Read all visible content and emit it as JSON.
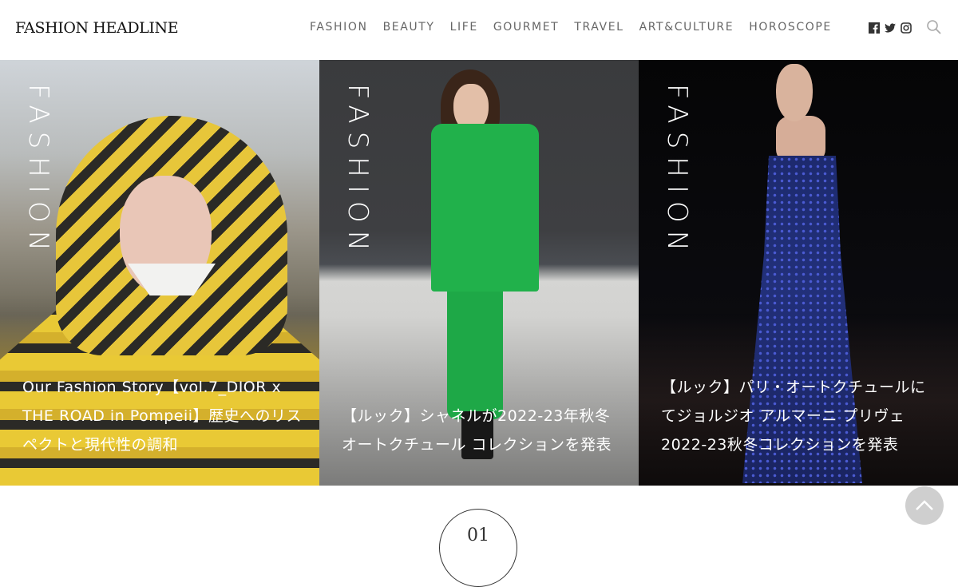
{
  "header": {
    "logo": "FASHION HEADLINE",
    "nav": [
      "FASHION",
      "BEAUTY",
      "LIFE",
      "GOURMET",
      "TRAVEL",
      "ART&CULTURE",
      "HOROSCOPE"
    ],
    "social_icons": [
      "facebook-icon",
      "twitter-icon",
      "instagram-icon"
    ],
    "search_icon": "search-icon"
  },
  "panels": [
    {
      "category": "FASHION",
      "title": "Our Fashion Story【vol.7_DIOR x THE ROAD in Pompeii】歴史へのリスペクトと現代性の調和"
    },
    {
      "category": "FASHION",
      "title": "【ルック】シャネルが2022-23年秋冬オートクチュール コレクションを発表"
    },
    {
      "category": "FASHION",
      "title": "【ルック】パリ・オートクチュールにてジョルジオ アルマーニ プリヴェ 2022-23秋冬コレクションを発表"
    }
  ],
  "ranking": {
    "number": "01"
  },
  "scroll_top_icon": "chevron-up-icon"
}
